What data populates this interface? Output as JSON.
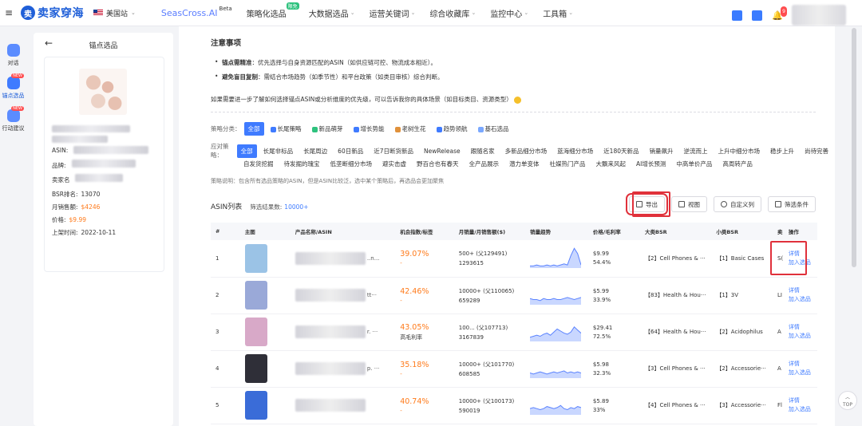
{
  "header": {
    "logo_text": "卖家穿海",
    "region": "美国站",
    "nav": [
      {
        "label": "SeasCross.AI",
        "extra": "Beta"
      },
      {
        "label": "策略化选品",
        "badge": "限免"
      },
      {
        "label": "大数据选品"
      },
      {
        "label": "运营关键词"
      },
      {
        "label": "综合收藏库"
      },
      {
        "label": "监控中心"
      },
      {
        "label": "工具箱"
      }
    ],
    "notify_count": "9"
  },
  "leftnav": [
    {
      "label": "对话",
      "new": ""
    },
    {
      "label": "锚点选品",
      "new": "NEW"
    },
    {
      "label": "行动建议",
      "new": "NEW"
    }
  ],
  "panel": {
    "title": "锚点选品",
    "asin_label": "ASIN:",
    "brand_label": "品牌:",
    "seller_label": "卖家名",
    "bsr_label": "BSR排名:",
    "bsr_value": "13070",
    "sales_label": "月销售额:",
    "sales_value": "$4246",
    "price_label": "价格:",
    "price_value": "$9.99",
    "date_label": "上架时间:",
    "date_value": "2022-10-11"
  },
  "notice": {
    "title": "注意事项",
    "bullets": [
      {
        "bold": "锚点需精准",
        "text": "：优先选择与自身资源匹配的ASIN（如供应链可控、物流成本相近）。"
      },
      {
        "bold": "避免盲目复制",
        "text": "：需结合市场趋势（如季节性）和平台政策（如类目审核）综合判断。"
      }
    ],
    "para": "如果需要进一步了解如何选择锚点ASIN或分析维度的优先级，可以告诉我你的具体场景（如目标类目、资源类型）"
  },
  "filters": {
    "cat_label": "策略分类：",
    "categories": [
      {
        "label": "全部",
        "color": ""
      },
      {
        "label": "长尾策略",
        "color": "#3f7bff"
      },
      {
        "label": "新品萌芽",
        "color": "#2ec27e"
      },
      {
        "label": "增长势能",
        "color": "#3f7bff"
      },
      {
        "label": "老树生花",
        "color": "#e0913b"
      },
      {
        "label": "趋势领航",
        "color": "#3f7bff"
      },
      {
        "label": "基石选品",
        "color": "#7aa8ff"
      }
    ],
    "strat_label": "应对策略：",
    "strategies_row1": [
      "全部",
      "长尾非标品",
      "长尾周边",
      "60日新品",
      "近7日断货新品",
      "NewRelease",
      "跟随名家",
      "多新品细分市场",
      "蓝海细分市场",
      "近180天新品",
      "销量飙升",
      "逆流而上",
      "上升中细分市场",
      "稳步上升",
      "尚待完善"
    ],
    "strategies_row2": [
      "自发货挖掘",
      "待发掘的瑰宝",
      "低垄断细分市场",
      "避实击虚",
      "野百合也有春天",
      "全产品展示",
      "潜力单变体",
      "社媒热门产品",
      "大飘来风起",
      "AI增长预测",
      "中高单价产品",
      "高周转产品"
    ],
    "note": "策略说明：包含所有选品策略的ASIN，但是ASIN比较泛，选中某个策略后，再选品会更加聚焦"
  },
  "asin": {
    "title": "ASIN列表",
    "count_label": "筛选结果数:",
    "count_value": "10000+",
    "buttons": {
      "export": "导出",
      "view": "视图",
      "custom": "自定义列",
      "filter": "筛选条件"
    }
  },
  "table": {
    "headers": [
      "#",
      "主图",
      "产品名称/ASIN",
      "机会指数/标签",
      "月销量/月销售额($)",
      "销量趋势",
      "价格/毛利率",
      "大类BSR",
      "小类BSR",
      "卖",
      "操作"
    ],
    "rows": [
      {
        "idx": "1",
        "tail": "..n...",
        "pct": "39.07%",
        "tag": "-",
        "sales": "500+ (父129491)",
        "revenue": "1293615",
        "price": "$9.99",
        "margin": "54.4%",
        "bsr": "【2】Cell Phones & ···",
        "sub": "【1】Basic Cases",
        "seller": "S(",
        "color": "#9bc3e6",
        "spark": [
          2,
          2,
          3,
          2,
          2,
          3,
          2,
          3,
          2,
          3,
          4,
          3,
          12,
          19,
          14,
          3
        ]
      },
      {
        "idx": "2",
        "tail": "tt···",
        "pct": "42.46%",
        "tag": "-",
        "sales": "10000+ (父110065)",
        "revenue": "659289",
        "price": "$5.99",
        "margin": "33.9%",
        "bsr": "【83】Health & Hou···",
        "sub": "【1】3V",
        "seller": "LI",
        "color": "#9aa9d8",
        "spark": [
          6,
          5,
          5,
          4,
          6,
          5,
          5,
          6,
          5,
          5,
          6,
          7,
          6,
          5,
          6,
          7
        ]
      },
      {
        "idx": "3",
        "tail": "r. ···",
        "pct": "43.05%",
        "tag": "高毛利率",
        "sales": "100... (父107713)",
        "revenue": "3167839",
        "price": "$29.41",
        "margin": "72.5%",
        "bsr": "【64】Health & Hou···",
        "sub": "【2】Acidophilus",
        "seller": "A",
        "color": "#d8a9c8",
        "spark": [
          4,
          5,
          6,
          5,
          7,
          8,
          6,
          9,
          12,
          10,
          8,
          7,
          9,
          14,
          11,
          8
        ]
      },
      {
        "idx": "4",
        "tail": "p. ···",
        "pct": "35.18%",
        "tag": "-",
        "sales": "10000+ (父101770)",
        "revenue": "608585",
        "price": "$5.98",
        "margin": "32.3%",
        "bsr": "【3】Cell Phones & ···",
        "sub": "【2】Accessorie···",
        "seller": "A",
        "color": "#2f2f38",
        "spark": [
          5,
          4,
          5,
          6,
          5,
          4,
          5,
          6,
          5,
          6,
          7,
          5,
          6,
          5,
          6,
          5
        ]
      },
      {
        "idx": "5",
        "tail": "",
        "pct": "40.74%",
        "tag": "-",
        "sales": "10000+ (父100173)",
        "revenue": "590019",
        "price": "$5.89",
        "margin": "33%",
        "bsr": "【4】Cell Phones & ···",
        "sub": "【3】Accessorie···",
        "seller": "Fl",
        "color": "#3a6cd8",
        "spark": [
          6,
          7,
          6,
          5,
          6,
          8,
          7,
          6,
          7,
          9,
          6,
          5,
          7,
          6,
          8,
          7
        ]
      }
    ],
    "ops": {
      "detail": "详情",
      "add": "加入选品"
    }
  },
  "top_label": "TOP"
}
